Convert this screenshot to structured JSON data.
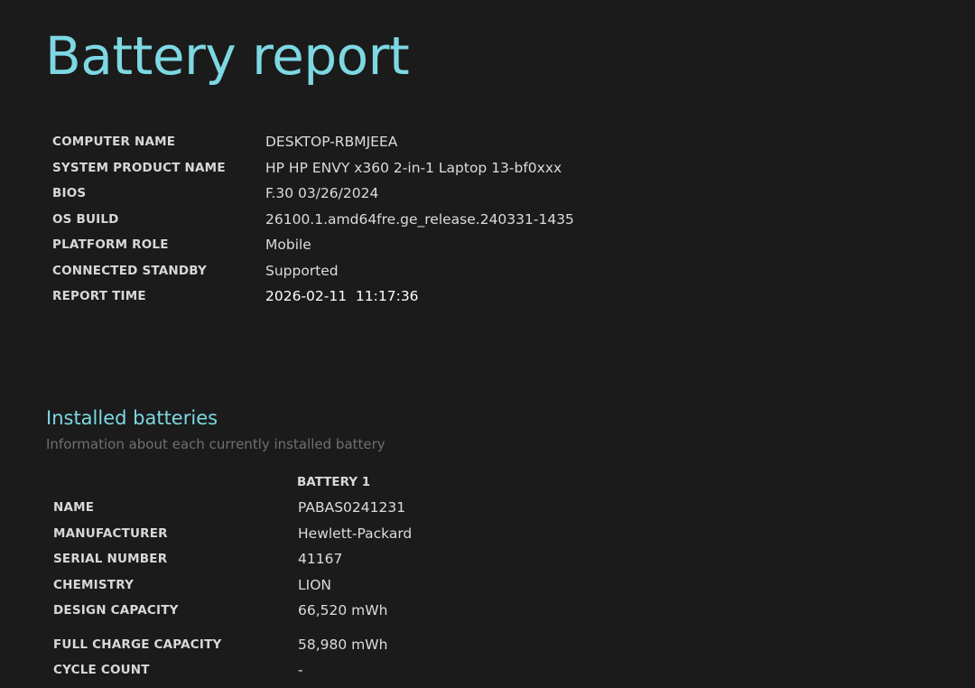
{
  "title": "Battery report",
  "system_info": [
    {
      "label": "COMPUTER NAME",
      "value": "DESKTOP-RBMJEEA"
    },
    {
      "label": "SYSTEM PRODUCT NAME",
      "value": "HP HP ENVY x360 2-in-1 Laptop 13-bf0xxx"
    },
    {
      "label": "BIOS",
      "value": "F.30 03/26/2024"
    },
    {
      "label": "OS BUILD",
      "value": "26100.1.amd64fre.ge_release.240331-1435"
    },
    {
      "label": "PLATFORM ROLE",
      "value": "Mobile"
    },
    {
      "label": "CONNECTED STANDBY",
      "value": "Supported"
    },
    {
      "label": "REPORT TIME",
      "value": "2026-02-11  11:17:36"
    }
  ],
  "installed_batteries": {
    "title": "Installed batteries",
    "subtitle": "Information about each currently installed battery",
    "column_header": "BATTERY 1",
    "rows": [
      {
        "label": "NAME",
        "value": "PABAS0241231"
      },
      {
        "label": "MANUFACTURER",
        "value": "Hewlett-Packard"
      },
      {
        "label": "SERIAL NUMBER",
        "value": "41167"
      },
      {
        "label": "CHEMISTRY",
        "value": "LION"
      },
      {
        "label": "DESIGN CAPACITY",
        "value": "66,520 mWh"
      },
      {
        "label": "FULL CHARGE CAPACITY",
        "value": "58,980 mWh"
      },
      {
        "label": "CYCLE COUNT",
        "value": "-"
      }
    ]
  },
  "colors": {
    "background": "#1b1b1b",
    "accent": "#7dd8e3",
    "subtitle": "#6f6f6f"
  }
}
